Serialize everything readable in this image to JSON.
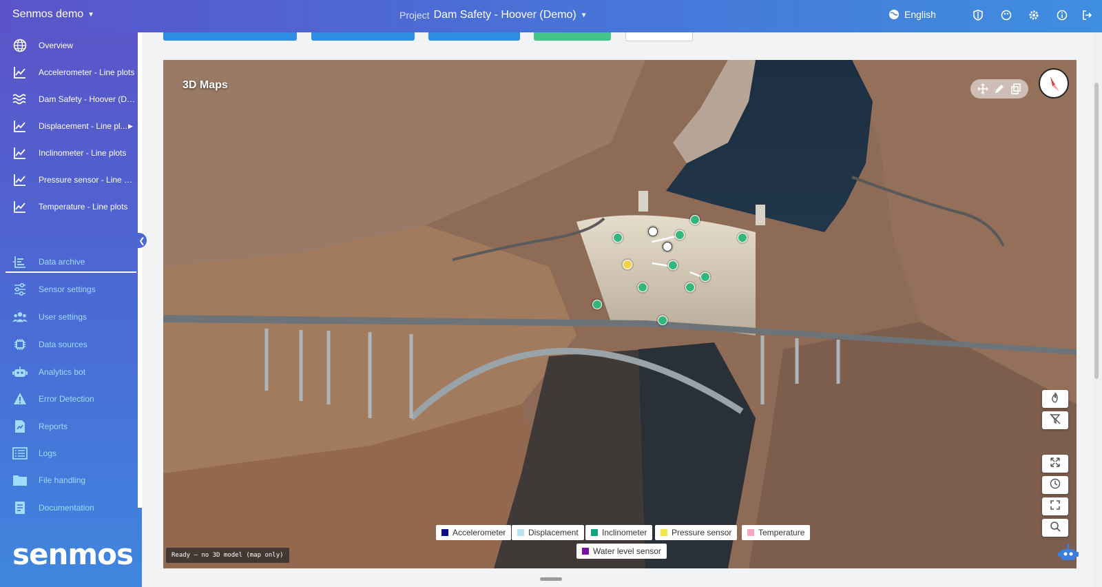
{
  "header": {
    "app_name": "Senmos demo",
    "project_label": "Project",
    "project_name": "Dam Safety - Hoover (Demo)",
    "language": "English"
  },
  "sidebar": {
    "items": [
      {
        "label": "Overview",
        "icon": "globe-icon"
      },
      {
        "label": "Accelerometer - Line plots",
        "icon": "line-chart-icon"
      },
      {
        "label": "Dam Safety - Hoover (De...",
        "icon": "waves-icon"
      },
      {
        "label": "Displacement - Line pl...",
        "icon": "line-chart-icon"
      },
      {
        "label": "Inclinometer - Line plots",
        "icon": "line-chart-icon"
      },
      {
        "label": "Pressure sensor - Line plo...",
        "icon": "line-chart-icon"
      },
      {
        "label": "Temperature - Line plots",
        "icon": "line-chart-icon"
      }
    ],
    "separator_text": "-",
    "tools": [
      {
        "label": "Data archive",
        "icon": "archive-icon"
      },
      {
        "label": "Sensor settings",
        "icon": "sliders-icon"
      },
      {
        "label": "User settings",
        "icon": "users-icon"
      },
      {
        "label": "Data sources",
        "icon": "chip-icon"
      },
      {
        "label": "Analytics bot",
        "icon": "robot-icon"
      },
      {
        "label": "Error Detection",
        "icon": "warning-icon"
      },
      {
        "label": "Reports",
        "icon": "report-icon"
      },
      {
        "label": "Logs",
        "icon": "list-icon"
      },
      {
        "label": "File handling",
        "icon": "folder-icon"
      },
      {
        "label": "Documentation",
        "icon": "document-icon"
      }
    ],
    "logo_text": "senmos"
  },
  "map": {
    "title": "3D Maps",
    "status": "Ready — no 3D model (map only)",
    "legend": [
      {
        "label": "Accelerometer",
        "color": "#0b0b8c"
      },
      {
        "label": "Displacement",
        "color": "#b9e3f4"
      },
      {
        "label": "Inclinometer",
        "color": "#13a07e"
      },
      {
        "label": "Pressure sensor",
        "color": "#f3e34c"
      },
      {
        "label": "Temperature",
        "color": "#f7a6c6"
      },
      {
        "label": "Water level sensor",
        "color": "#7a0ba8"
      }
    ]
  },
  "colors": {
    "accent_light": "#9fdcff",
    "sidebar_top": "#5a55c8",
    "sidebar_bottom": "#3f86de"
  }
}
